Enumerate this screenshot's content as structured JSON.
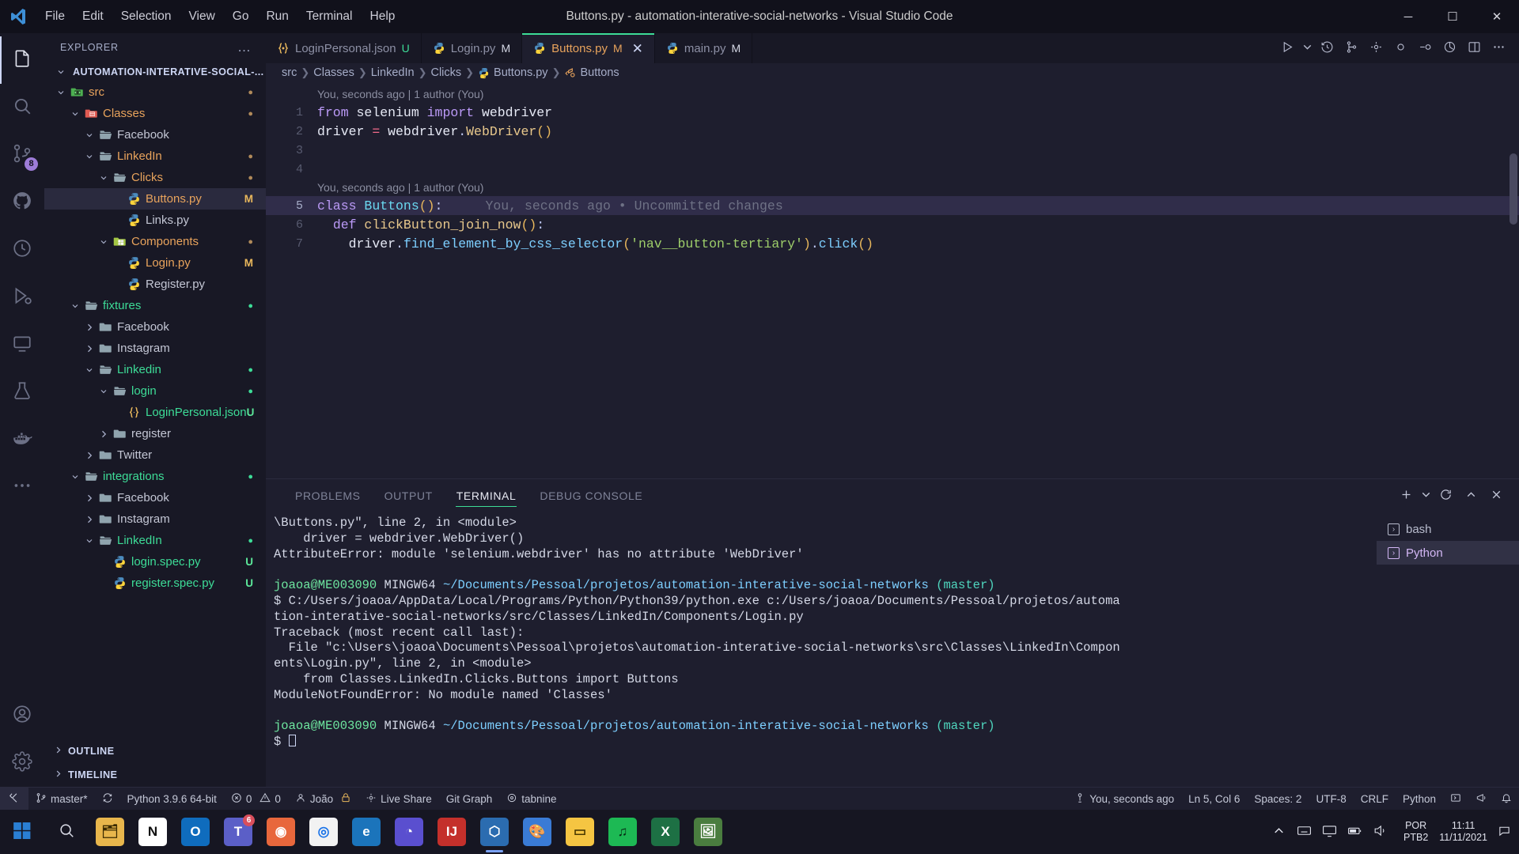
{
  "titlebar": {
    "menus": [
      "File",
      "Edit",
      "Selection",
      "View",
      "Go",
      "Run",
      "Terminal",
      "Help"
    ],
    "title": "Buttons.py - automation-interative-social-networks - Visual Studio Code",
    "minimize": "─",
    "maximize": "☐",
    "close": "✕"
  },
  "activitybar": {
    "items": [
      {
        "name": "explorer",
        "icon": "files-icon",
        "active": true,
        "badge": ""
      },
      {
        "name": "search",
        "icon": "search-icon",
        "active": false,
        "badge": ""
      },
      {
        "name": "source-control",
        "icon": "source-control-icon",
        "active": false,
        "badge": "8"
      },
      {
        "name": "github",
        "icon": "github-icon",
        "active": false,
        "badge": ""
      },
      {
        "name": "timeline",
        "icon": "clock-icon",
        "active": false,
        "badge": ""
      },
      {
        "name": "run-and-debug",
        "icon": "debug-icon",
        "active": false,
        "badge": ""
      },
      {
        "name": "remote-explorer",
        "icon": "remote-icon",
        "active": false,
        "badge": ""
      },
      {
        "name": "testing",
        "icon": "beaker-icon",
        "active": false,
        "badge": ""
      },
      {
        "name": "docker",
        "icon": "docker-icon",
        "active": false,
        "badge": ""
      },
      {
        "name": "more",
        "icon": "ellipsis-icon",
        "active": false,
        "badge": ""
      }
    ],
    "bottom": [
      {
        "name": "accounts",
        "icon": "account-icon"
      },
      {
        "name": "settings",
        "icon": "gear-icon"
      }
    ]
  },
  "sidebar": {
    "header": "EXPLORER",
    "more": "…",
    "root": "AUTOMATION-INTERATIVE-SOCIAL-...",
    "tree": [
      {
        "label": "src",
        "depth": 1,
        "kind": "folder-src",
        "expanded": true,
        "color": "orange",
        "badge": "●",
        "badgeColor": "#b08a5a"
      },
      {
        "label": "Classes",
        "depth": 2,
        "kind": "folder-class",
        "expanded": true,
        "color": "orange",
        "badge": "●",
        "badgeColor": "#b08a5a"
      },
      {
        "label": "Facebook",
        "depth": 3,
        "kind": "folder-open",
        "expanded": true,
        "color": "plain",
        "badge": ""
      },
      {
        "label": "LinkedIn",
        "depth": 3,
        "kind": "folder-open",
        "expanded": true,
        "color": "orange",
        "badge": "●",
        "badgeColor": "#b08a5a"
      },
      {
        "label": "Clicks",
        "depth": 4,
        "kind": "folder-open",
        "expanded": true,
        "color": "orange",
        "badge": "●",
        "badgeColor": "#b08a5a"
      },
      {
        "label": "Buttons.py",
        "depth": 5,
        "kind": "python",
        "expanded": null,
        "color": "orange",
        "badge": "M",
        "badgeColor": "#e8b75c",
        "selected": true
      },
      {
        "label": "Links.py",
        "depth": 5,
        "kind": "python",
        "expanded": null,
        "color": "plain",
        "badge": ""
      },
      {
        "label": "Components",
        "depth": 4,
        "kind": "folder-comp",
        "expanded": true,
        "color": "orange",
        "badge": "●",
        "badgeColor": "#b08a5a"
      },
      {
        "label": "Login.py",
        "depth": 5,
        "kind": "python",
        "expanded": null,
        "color": "orange",
        "badge": "M",
        "badgeColor": "#e8b75c"
      },
      {
        "label": "Register.py",
        "depth": 5,
        "kind": "python",
        "expanded": null,
        "color": "plain",
        "badge": ""
      },
      {
        "label": "fixtures",
        "depth": 2,
        "kind": "folder-open",
        "expanded": true,
        "color": "green",
        "badge": "●",
        "badgeColor": "#3ddc97"
      },
      {
        "label": "Facebook",
        "depth": 3,
        "kind": "folder-closed",
        "expanded": false,
        "color": "plain",
        "badge": ""
      },
      {
        "label": "Instagram",
        "depth": 3,
        "kind": "folder-closed",
        "expanded": false,
        "color": "plain",
        "badge": ""
      },
      {
        "label": "Linkedin",
        "depth": 3,
        "kind": "folder-open",
        "expanded": true,
        "color": "green",
        "badge": "●",
        "badgeColor": "#3ddc97"
      },
      {
        "label": "login",
        "depth": 4,
        "kind": "folder-open",
        "expanded": true,
        "color": "green",
        "badge": "●",
        "badgeColor": "#3ddc97"
      },
      {
        "label": "LoginPersonal.json",
        "depth": 5,
        "kind": "json",
        "expanded": null,
        "color": "green",
        "badge": "U",
        "badgeColor": "#5ce89a"
      },
      {
        "label": "register",
        "depth": 4,
        "kind": "folder-closed",
        "expanded": false,
        "color": "plain",
        "badge": ""
      },
      {
        "label": "Twitter",
        "depth": 3,
        "kind": "folder-closed",
        "expanded": false,
        "color": "plain",
        "badge": ""
      },
      {
        "label": "integrations",
        "depth": 2,
        "kind": "folder-open",
        "expanded": true,
        "color": "green",
        "badge": "●",
        "badgeColor": "#3ddc97"
      },
      {
        "label": "Facebook",
        "depth": 3,
        "kind": "folder-closed",
        "expanded": false,
        "color": "plain",
        "badge": ""
      },
      {
        "label": "Instagram",
        "depth": 3,
        "kind": "folder-closed",
        "expanded": false,
        "color": "plain",
        "badge": ""
      },
      {
        "label": "LinkedIn",
        "depth": 3,
        "kind": "folder-open",
        "expanded": true,
        "color": "green",
        "badge": "●",
        "badgeColor": "#3ddc97"
      },
      {
        "label": "login.spec.py",
        "depth": 4,
        "kind": "python",
        "expanded": null,
        "color": "green",
        "badge": "U",
        "badgeColor": "#5ce89a"
      },
      {
        "label": "register.spec.py",
        "depth": 4,
        "kind": "python",
        "expanded": null,
        "color": "green",
        "badge": "U",
        "badgeColor": "#5ce89a"
      }
    ],
    "sections": [
      "OUTLINE",
      "TIMELINE"
    ]
  },
  "tabs": [
    {
      "label": "LoginPersonal.json",
      "status": "U",
      "icon": "json-icon",
      "active": false,
      "closable": false
    },
    {
      "label": "Login.py",
      "status": "M",
      "icon": "python-icon",
      "active": false,
      "closable": false
    },
    {
      "label": "Buttons.py",
      "status": "M",
      "icon": "python-icon",
      "active": true,
      "closable": true,
      "close": "✕"
    },
    {
      "label": "main.py",
      "status": "M",
      "icon": "python-icon",
      "active": false,
      "closable": false
    }
  ],
  "editor_actions": [
    {
      "name": "run-python-file",
      "icon": "play-icon"
    },
    {
      "name": "run-dropdown",
      "icon": "chevron-down-icon"
    },
    {
      "name": "timeline-history",
      "icon": "history-icon"
    },
    {
      "name": "source-control-graph",
      "icon": "git-graph-icon"
    },
    {
      "name": "live-share",
      "icon": "live-share-icon"
    },
    {
      "name": "record-start",
      "icon": "record-icon"
    },
    {
      "name": "step-over",
      "icon": "step-icon"
    },
    {
      "name": "coverage",
      "icon": "coverage-icon"
    },
    {
      "name": "split-editor",
      "icon": "split-editor-icon"
    },
    {
      "name": "more-actions",
      "icon": "ellipsis-icon"
    }
  ],
  "breadcrumb": [
    "src",
    "Classes",
    "LinkedIn",
    "Clicks",
    "Buttons.py",
    "Buttons"
  ],
  "breadcrumb_icons": {
    "file": "python-icon",
    "symbol": "class-symbol-icon"
  },
  "code": {
    "codelens_1": "You, seconds ago | 1 author (You)",
    "codelens_2": "You, seconds ago | 1 author (You)",
    "inline_annotation": "You, seconds ago • Uncommitted changes",
    "lines": [
      {
        "n": "1",
        "segments": [
          {
            "t": "from ",
            "c": "k-kw"
          },
          {
            "t": "selenium ",
            "c": "k-mod"
          },
          {
            "t": "import ",
            "c": "k-kw"
          },
          {
            "t": "webdriver",
            "c": "k-mod"
          }
        ]
      },
      {
        "n": "2",
        "segments": [
          {
            "t": "driver ",
            "c": "k-var"
          },
          {
            "t": "= ",
            "c": "k-op"
          },
          {
            "t": "webdriver",
            "c": "k-var"
          },
          {
            "t": ".",
            "c": "k-punc"
          },
          {
            "t": "WebDriver",
            "c": "k-fn"
          },
          {
            "t": "()",
            "c": "k-par"
          }
        ]
      },
      {
        "n": "3",
        "segments": []
      },
      {
        "n": "4",
        "segments": []
      },
      {
        "n": "5",
        "segments": [
          {
            "t": "class ",
            "c": "k-def"
          },
          {
            "t": "Buttons",
            "c": "k-cls"
          },
          {
            "t": "()",
            "c": "k-par"
          },
          {
            "t": ":",
            "c": "k-punc"
          }
        ],
        "highlight": true
      },
      {
        "n": "6",
        "segments": [
          {
            "t": "  ",
            "c": "k-punc"
          },
          {
            "t": "def ",
            "c": "k-def"
          },
          {
            "t": "clickButton_join_now",
            "c": "k-fn"
          },
          {
            "t": "()",
            "c": "k-par"
          },
          {
            "t": ":",
            "c": "k-punc"
          }
        ]
      },
      {
        "n": "7",
        "segments": [
          {
            "t": "    ",
            "c": "k-punc"
          },
          {
            "t": "driver",
            "c": "k-var"
          },
          {
            "t": ".",
            "c": "k-punc"
          },
          {
            "t": "find_element_by_css_selector",
            "c": "k-mem"
          },
          {
            "t": "(",
            "c": "k-par"
          },
          {
            "t": "'nav__button-tertiary'",
            "c": "k-str"
          },
          {
            "t": ")",
            "c": "k-par"
          },
          {
            "t": ".",
            "c": "k-punc"
          },
          {
            "t": "click",
            "c": "k-mem"
          },
          {
            "t": "()",
            "c": "k-par"
          }
        ]
      }
    ]
  },
  "panel": {
    "tabs": [
      "PROBLEMS",
      "OUTPUT",
      "TERMINAL",
      "DEBUG CONSOLE"
    ],
    "active_tab": "TERMINAL",
    "actions": [
      {
        "name": "new-terminal",
        "icon": "plus-icon"
      },
      {
        "name": "terminal-dropdown",
        "icon": "chevron-down-icon"
      },
      {
        "name": "restart-terminal",
        "icon": "refresh-icon"
      },
      {
        "name": "maximize-panel",
        "icon": "chevron-up-icon"
      },
      {
        "name": "close-panel",
        "icon": "close-icon"
      }
    ],
    "terminal_list": [
      {
        "label": "bash",
        "active": false
      },
      {
        "label": "Python",
        "active": true
      }
    ],
    "terminal_lines": [
      [
        {
          "t": "\\Buttons.py\", line 2, in <module>",
          "c": "t-white"
        }
      ],
      [
        {
          "t": "    driver = webdriver.WebDriver()",
          "c": "t-white"
        }
      ],
      [
        {
          "t": "AttributeError: module 'selenium.webdriver' has no attribute 'WebDriver'",
          "c": "t-white"
        }
      ],
      [
        {
          "t": "",
          "c": "t-white"
        }
      ],
      [
        {
          "t": "joaoa@ME003090 ",
          "c": "t-green"
        },
        {
          "t": "MINGW64 ",
          "c": "t-white"
        },
        {
          "t": "~/Documents/Pessoal/projetos/automation-interative-social-networks ",
          "c": "t-blue"
        },
        {
          "t": "(master)",
          "c": "t-cyan"
        }
      ],
      [
        {
          "t": "$ ",
          "c": "t-white"
        },
        {
          "t": "C:/Users/joaoa/AppData/Local/Programs/Python/Python39/python.exe c:/Users/joaoa/Documents/Pessoal/projetos/automa",
          "c": "t-white"
        }
      ],
      [
        {
          "t": "tion-interative-social-networks/src/Classes/LinkedIn/Components/Login.py",
          "c": "t-white"
        }
      ],
      [
        {
          "t": "Traceback (most recent call last):",
          "c": "t-white"
        }
      ],
      [
        {
          "t": "  File \"c:\\Users\\joaoa\\Documents\\Pessoal\\projetos\\automation-interative-social-networks\\src\\Classes\\LinkedIn\\Compon",
          "c": "t-white"
        }
      ],
      [
        {
          "t": "ents\\Login.py\", line 2, in <module>",
          "c": "t-white"
        }
      ],
      [
        {
          "t": "    from Classes.LinkedIn.Clicks.Buttons import Buttons",
          "c": "t-white"
        }
      ],
      [
        {
          "t": "ModuleNotFoundError: No module named 'Classes'",
          "c": "t-white"
        }
      ],
      [
        {
          "t": "",
          "c": "t-white"
        }
      ],
      [
        {
          "t": "joaoa@ME003090 ",
          "c": "t-green"
        },
        {
          "t": "MINGW64 ",
          "c": "t-white"
        },
        {
          "t": "~/Documents/Pessoal/projetos/automation-interative-social-networks ",
          "c": "t-blue"
        },
        {
          "t": "(master)",
          "c": "t-cyan"
        }
      ],
      [
        {
          "t": "$ ",
          "c": "t-white"
        }
      ]
    ]
  },
  "statusbar": {
    "branch": "master*",
    "sync_icon": "sync-icon",
    "python_version": "Python 3.9.6 64-bit",
    "errors": "0",
    "warnings": "0",
    "user": "João",
    "lock_icon": "lock-icon",
    "live_share": "Live Share",
    "git_graph": "Git Graph",
    "tabnine": "tabnine",
    "blame": "You, seconds ago",
    "cursor": "Ln 5, Col 6",
    "spaces": "Spaces: 2",
    "encoding": "UTF-8",
    "eol": "CRLF",
    "language": "Python",
    "feedback_icon": "smiley-icon",
    "bell_icon": "bell-icon",
    "broadcast_icon": "broadcast-icon"
  },
  "taskbar": {
    "start_icon": "windows-start-icon",
    "search_icon": "search-icon",
    "apps": [
      {
        "name": "file-explorer",
        "glyph": "🗂",
        "bg": "#e8b64c",
        "color": "#3a2a00",
        "badge": ""
      },
      {
        "name": "notion",
        "glyph": "N",
        "bg": "#ffffff",
        "color": "#101010",
        "badge": ""
      },
      {
        "name": "outlook",
        "glyph": "O",
        "bg": "#0f6cbd",
        "color": "#ffffff",
        "badge": ""
      },
      {
        "name": "microsoft-teams",
        "glyph": "T",
        "bg": "#5b5fc7",
        "color": "#ffffff",
        "badge": "6"
      },
      {
        "name": "firefox",
        "glyph": "◉",
        "bg": "#e8673c",
        "color": "#ffffff",
        "badge": ""
      },
      {
        "name": "google-chrome",
        "glyph": "◎",
        "bg": "#f2f2f2",
        "color": "#1a73e8",
        "badge": ""
      },
      {
        "name": "internet-explorer",
        "glyph": "e",
        "bg": "#1b74bb",
        "color": "#ffffff",
        "badge": ""
      },
      {
        "name": "insomnia",
        "glyph": "◔",
        "bg": "#5a4fcf",
        "color": "#ffffff",
        "badge": ""
      },
      {
        "name": "intellij-idea",
        "glyph": "IJ",
        "bg": "#c4302b",
        "color": "#ffffff",
        "badge": ""
      },
      {
        "name": "visual-studio-code",
        "glyph": "⬡",
        "bg": "#2b6cb0",
        "color": "#ffffff",
        "badge": "",
        "running": true
      },
      {
        "name": "paint",
        "glyph": "🎨",
        "bg": "#3a7bd5",
        "color": "#ffffff",
        "badge": ""
      },
      {
        "name": "sticky-notes",
        "glyph": "▭",
        "bg": "#f5c542",
        "color": "#4a3a00",
        "badge": ""
      },
      {
        "name": "spotify",
        "glyph": "♫",
        "bg": "#1db954",
        "color": "#062d14",
        "badge": ""
      },
      {
        "name": "excel",
        "glyph": "X",
        "bg": "#1d7044",
        "color": "#ffffff",
        "badge": ""
      },
      {
        "name": "photos",
        "glyph": "🖼",
        "bg": "#4a7d3f",
        "color": "#ffffff",
        "badge": ""
      }
    ],
    "tray_icons": [
      "chevron-up-icon",
      "keyboard-icon",
      "monitor-icon",
      "battery-icon",
      "volume-icon"
    ],
    "language_line1": "POR",
    "language_line2": "PTB2",
    "time": "11:11",
    "date": "11/11/2021",
    "notification_icon": "notification-icon"
  }
}
